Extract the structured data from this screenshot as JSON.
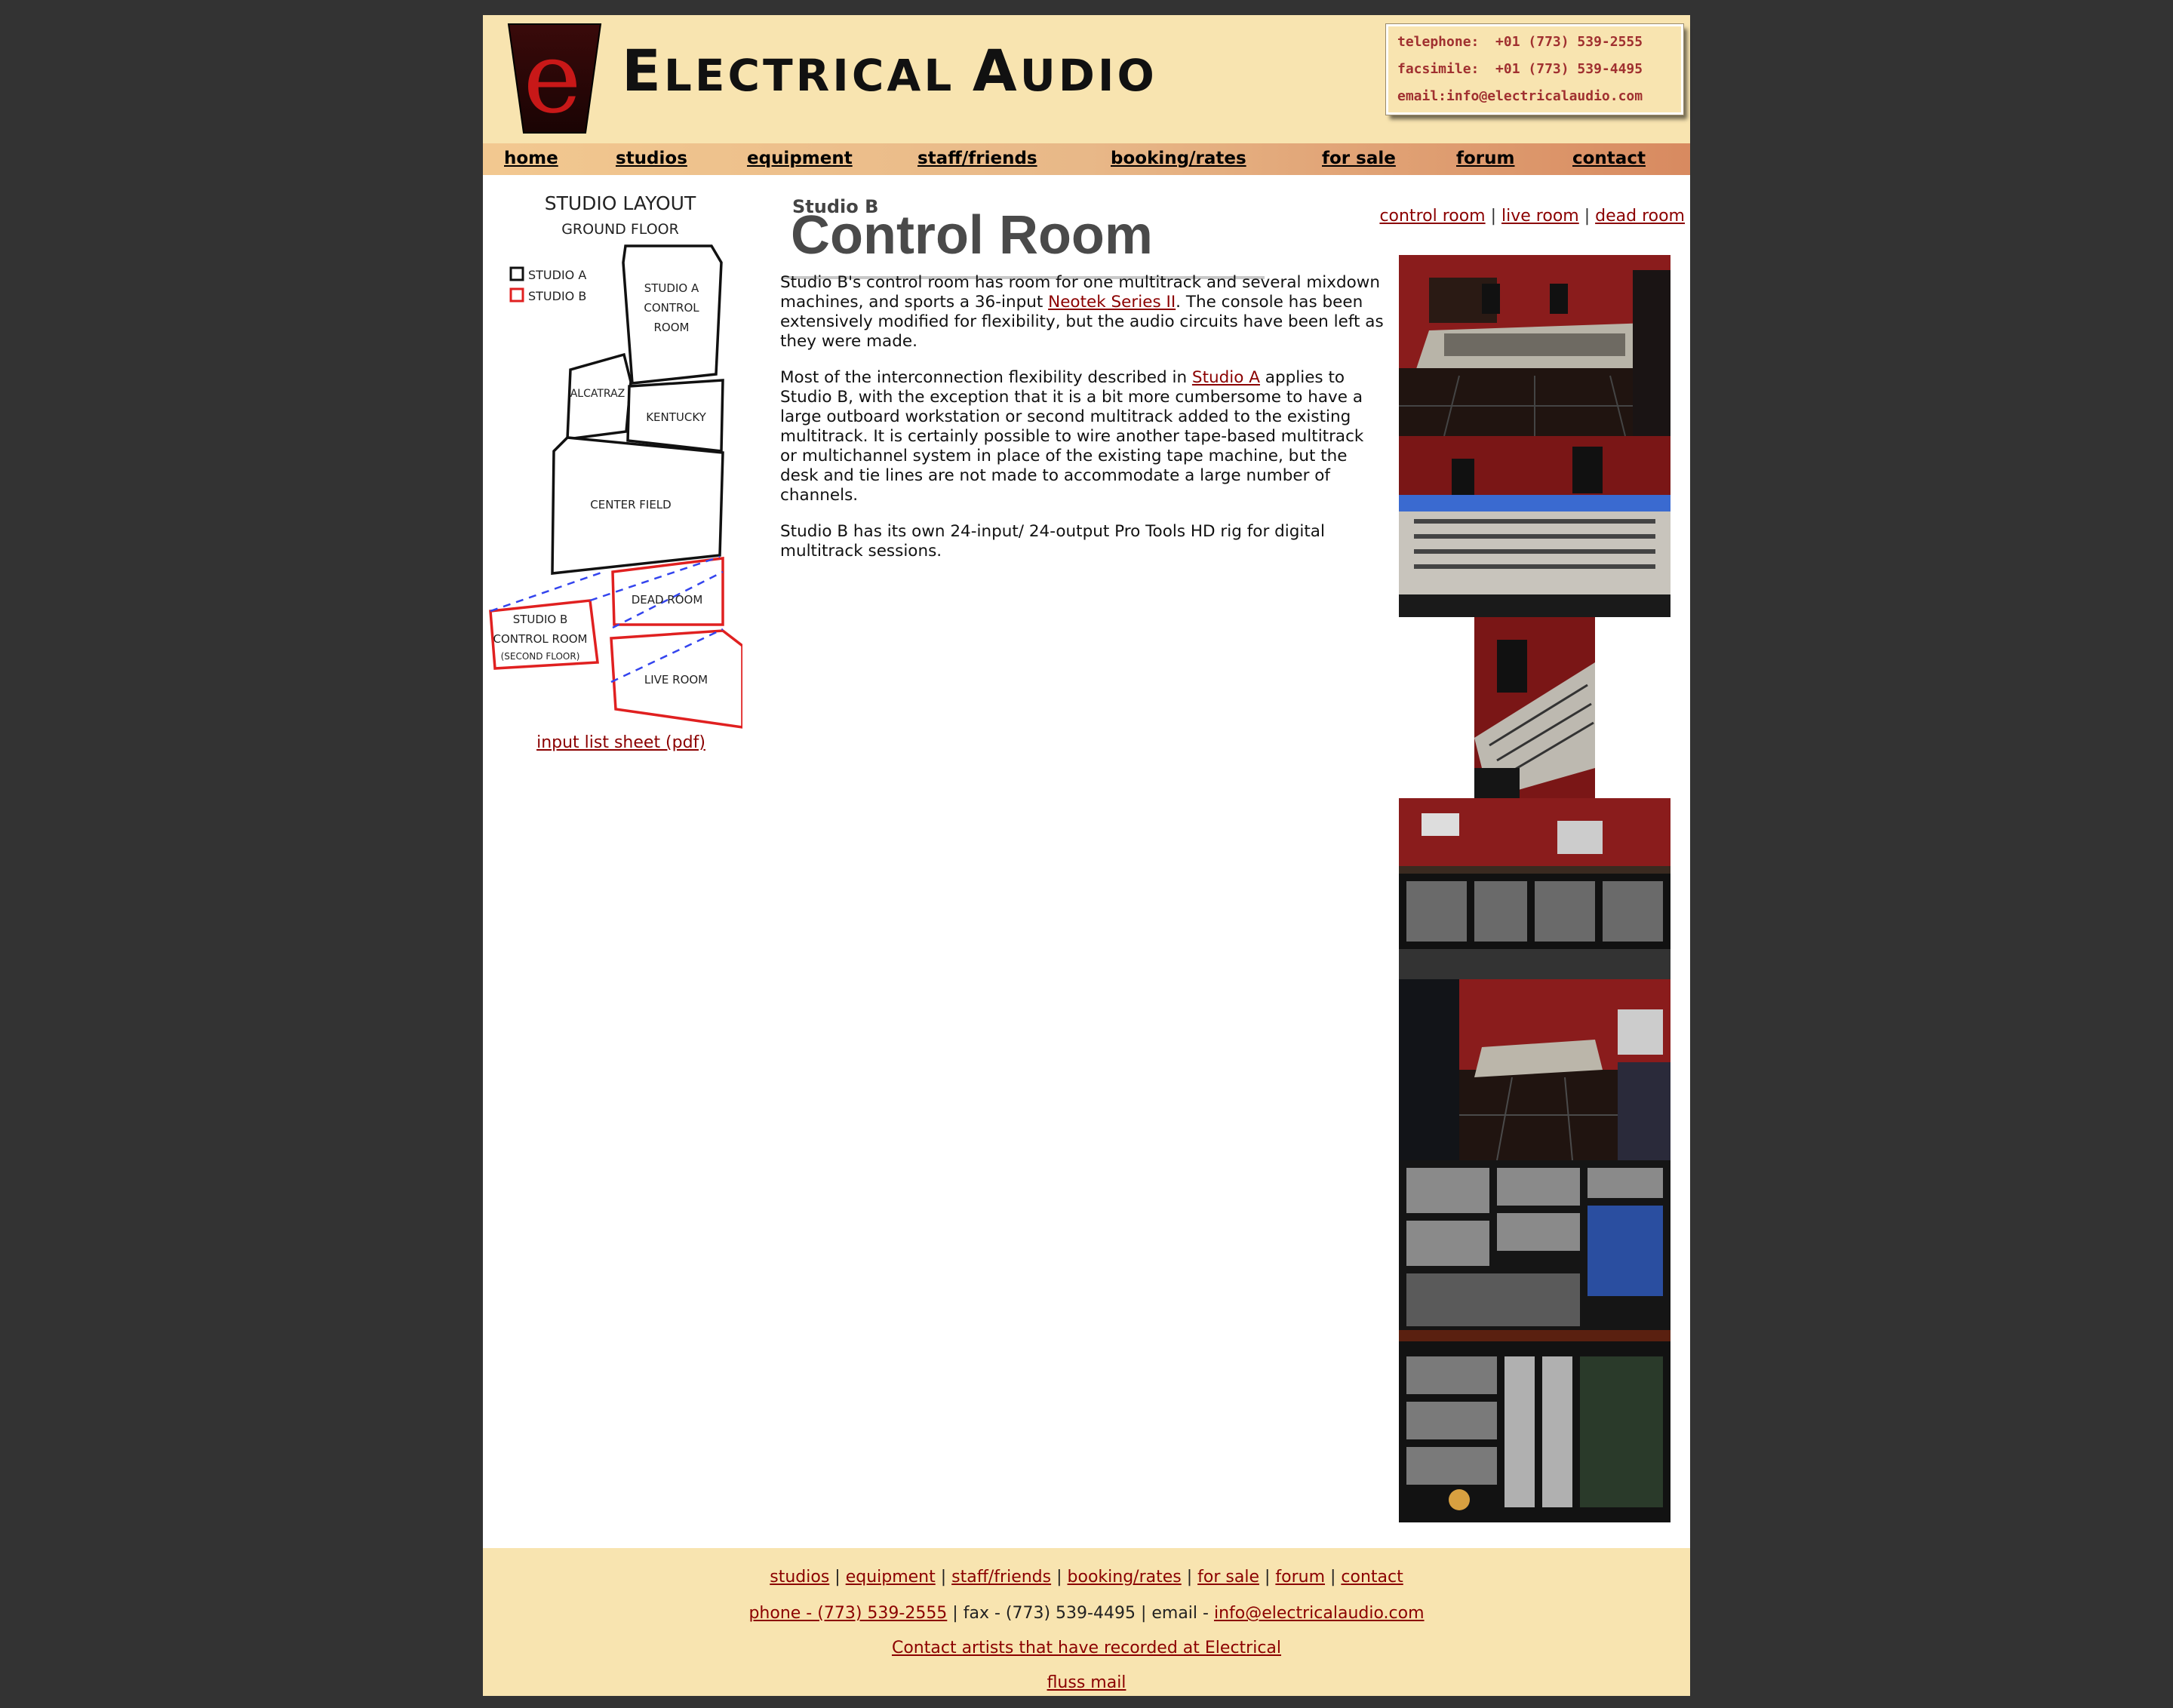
{
  "brand": {
    "name_initial_1": "E",
    "name_rest_1": "LECTRICAL",
    "name_initial_2": "A",
    "name_rest_2": "UDIO",
    "logo_letter": "e"
  },
  "contact_box": {
    "telephone": "telephone:  +01 (773) 539-2555",
    "facsimile": "facsimile:  +01 (773) 539-4495",
    "email": "email:info@electricalaudio.com"
  },
  "nav": [
    "home",
    "studios",
    "equipment",
    "staff/friends",
    "booking/rates",
    "for sale",
    "forum",
    "contact"
  ],
  "map": {
    "title": "STUDIO LAYOUT",
    "subtitle": "GROUND FLOOR",
    "legend_a": "STUDIO A",
    "legend_b": "STUDIO B",
    "room_a_ctrl_1": "STUDIO A",
    "room_a_ctrl_2": "CONTROL",
    "room_a_ctrl_3": "ROOM",
    "alcatraz": "ALCATRAZ",
    "kentucky": "KENTUCKY",
    "center_field": "CENTER FIELD",
    "dead_room": "DEAD ROOM",
    "live_room": "LIVE ROOM",
    "b_ctrl_1": "STUDIO B",
    "b_ctrl_2": "CONTROL ROOM",
    "b_ctrl_3": "(SECOND FLOOR)",
    "colors": {
      "studio_a": "#111111",
      "studio_b": "#e02020",
      "link_lines": "#3344ee"
    }
  },
  "input_list_link": "input list sheet (pdf)",
  "heading": {
    "kicker": "Studio B",
    "title": "Control Room"
  },
  "subnav": {
    "control": "control room",
    "live": "live room",
    "dead": "dead room",
    "sep": "|"
  },
  "body": {
    "p1_a": "Studio B's control room has room for one multitrack and several mixdown machines, and sports a 36-input ",
    "p1_link": "Neotek Series II",
    "p1_b": ". The console has been extensively modified for flexibility, but the audio circuits have been left as they were made.",
    "p2_a": "Most of the interconnection flexibility described in ",
    "p2_link": "Studio A",
    "p2_b": " applies to Studio B, with the exception that it is a bit more cumbersome to have a large outboard workstation or second multitrack added to the existing multitrack. It is certainly possible to wire another tape-based multitrack or multichannel system in place of the existing tape machine, but the desk and tie lines are not made to accommodate a large number of channels.",
    "p3": "Studio B has its own 24-input/ 24-output Pro Tools HD rig for digital multitrack sessions."
  },
  "footer": {
    "links": [
      "studios",
      "equipment",
      "staff/friends",
      "booking/rates",
      "for sale",
      "forum",
      "contact"
    ],
    "sep": " | ",
    "phone_link": "phone - (773) 539-2555",
    "fax_text": " | fax - (773) 539-4495 | email - ",
    "email_link": "info@electricalaudio.com",
    "artists_link": "Contact artists that have recorded at Electrical",
    "fluss_link": "fluss mail"
  },
  "colors": {
    "cream": "#f8e4b0",
    "link": "#8b0000",
    "frame": "#333333",
    "logo_red": "#b01818"
  }
}
